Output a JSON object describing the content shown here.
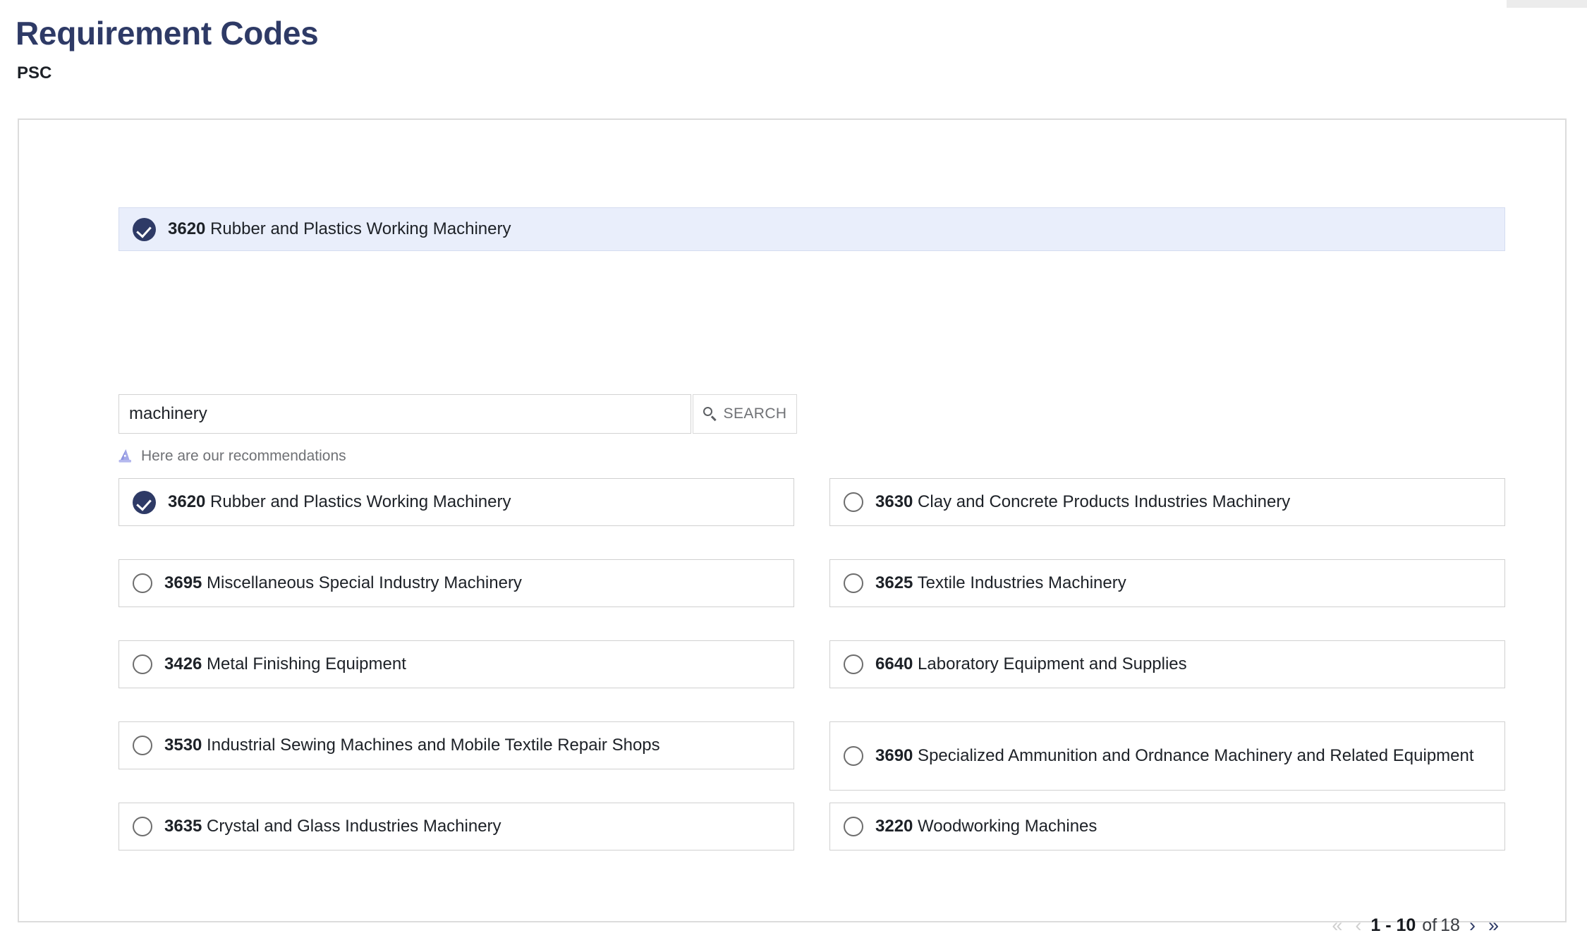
{
  "page": {
    "title": "Requirement Codes",
    "section_label": "PSC"
  },
  "selected_banner": {
    "code": "3620",
    "label": "Rubber and Plastics Working Machinery",
    "icon": "check-circle-icon",
    "background_color": "#e9eefb",
    "accent_color": "#2e3a66"
  },
  "search": {
    "value": "machinery",
    "placeholder": "",
    "button_label": "SEARCH",
    "button_icon": "search-icon"
  },
  "recommendation": {
    "icon": "wizard-hat-icon",
    "text": "Here are our recommendations",
    "icon_color": "#9ca2e0"
  },
  "options": [
    {
      "code": "3620",
      "label": "Rubber and Plastics Working Machinery",
      "selected": true
    },
    {
      "code": "3630",
      "label": "Clay and Concrete Products Industries Machinery",
      "selected": false
    },
    {
      "code": "3695",
      "label": "Miscellaneous Special Industry Machinery",
      "selected": false
    },
    {
      "code": "3625",
      "label": "Textile Industries Machinery",
      "selected": false
    },
    {
      "code": "3426",
      "label": "Metal Finishing Equipment",
      "selected": false
    },
    {
      "code": "6640",
      "label": "Laboratory Equipment and Supplies",
      "selected": false
    },
    {
      "code": "3530",
      "label": "Industrial Sewing Machines and Mobile Textile Repair Shops",
      "selected": false
    },
    {
      "code": "3690",
      "label": "Specialized Ammunition and Ordnance Machinery and Related Equipment",
      "selected": false
    },
    {
      "code": "3635",
      "label": "Crystal and Glass Industries Machinery",
      "selected": false
    },
    {
      "code": "3220",
      "label": "Woodworking Machines",
      "selected": false
    }
  ],
  "pagination": {
    "first_label": "«",
    "prev_label": "‹",
    "range": "1 - 10",
    "of_label": "of",
    "total": "18",
    "next_label": "›",
    "last_label": "»",
    "first_enabled": false,
    "prev_enabled": false,
    "next_enabled": true,
    "last_enabled": true
  }
}
